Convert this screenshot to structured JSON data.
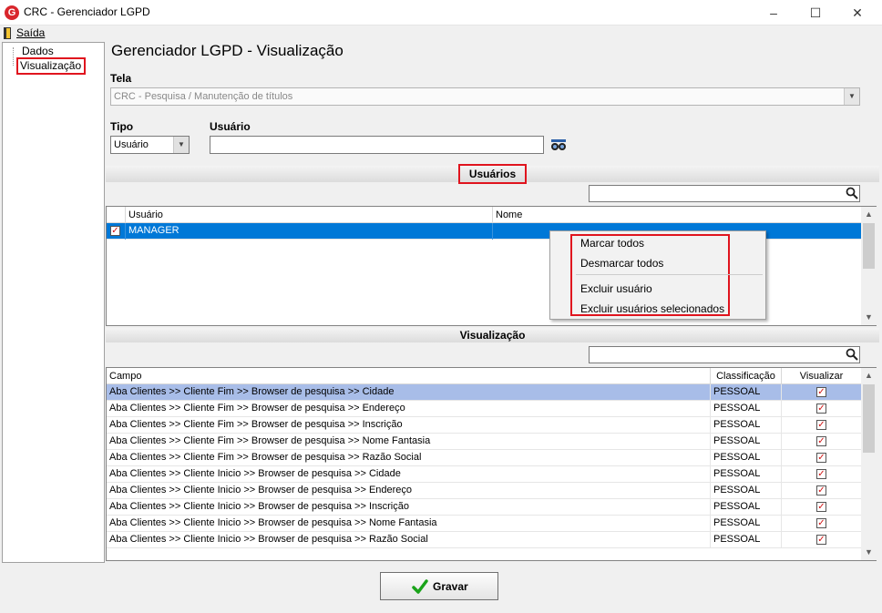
{
  "window": {
    "title": "CRC - Gerenciador LGPD",
    "app_icon_letter": "G",
    "minimize": "–",
    "maximize": "☐",
    "close": "✕"
  },
  "menu": {
    "exit_label": "Saída"
  },
  "tree": {
    "items": [
      "Dados",
      "Visualização"
    ]
  },
  "page": {
    "title": "Gerenciador LGPD - Visualização"
  },
  "tela": {
    "label": "Tela",
    "value": "CRC - Pesquisa / Manutenção de títulos"
  },
  "tipo": {
    "label": "Tipo",
    "value": "Usuário"
  },
  "usuario": {
    "label": "Usuário",
    "value": ""
  },
  "users_section": {
    "title": "Usuários",
    "columns": [
      "Usuário",
      "Nome"
    ],
    "rows": [
      {
        "checked": true,
        "user": "MANAGER",
        "name": ""
      }
    ]
  },
  "context_menu": {
    "items": [
      "Marcar todos",
      "Desmarcar todos",
      "Excluir usuário",
      "Excluir usuários selecionados"
    ]
  },
  "view_section": {
    "title": "Visualização",
    "columns": [
      "Campo",
      "Classificação",
      "Visualizar"
    ],
    "rows": [
      {
        "campo": "Aba Clientes >> Cliente Fim >> Browser de pesquisa >> Cidade",
        "classificacao": "PESSOAL",
        "visualizar": true
      },
      {
        "campo": "Aba Clientes >> Cliente Fim >> Browser de pesquisa >> Endereço",
        "classificacao": "PESSOAL",
        "visualizar": true
      },
      {
        "campo": "Aba Clientes >> Cliente Fim >> Browser de pesquisa >> Inscrição",
        "classificacao": "PESSOAL",
        "visualizar": true
      },
      {
        "campo": "Aba Clientes >> Cliente Fim >> Browser de pesquisa >> Nome Fantasia",
        "classificacao": "PESSOAL",
        "visualizar": true
      },
      {
        "campo": "Aba Clientes >> Cliente Fim >> Browser de pesquisa >> Razão Social",
        "classificacao": "PESSOAL",
        "visualizar": true
      },
      {
        "campo": "Aba Clientes >> Cliente Inicio >> Browser de pesquisa >> Cidade",
        "classificacao": "PESSOAL",
        "visualizar": true
      },
      {
        "campo": "Aba Clientes >> Cliente Inicio >> Browser de pesquisa >> Endereço",
        "classificacao": "PESSOAL",
        "visualizar": true
      },
      {
        "campo": "Aba Clientes >> Cliente Inicio >> Browser de pesquisa >> Inscrição",
        "classificacao": "PESSOAL",
        "visualizar": true
      },
      {
        "campo": "Aba Clientes >> Cliente Inicio >> Browser de pesquisa >> Nome Fantasia",
        "classificacao": "PESSOAL",
        "visualizar": true
      },
      {
        "campo": "Aba Clientes >> Cliente Inicio >> Browser de pesquisa >> Razão Social",
        "classificacao": "PESSOAL",
        "visualizar": true
      }
    ]
  },
  "save_button": {
    "label": "Gravar"
  },
  "colors": {
    "selection": "#0078d7",
    "highlight_row": "#a8bde8",
    "annotation_red": "#e0141e",
    "check_green": "#1aa31a"
  }
}
